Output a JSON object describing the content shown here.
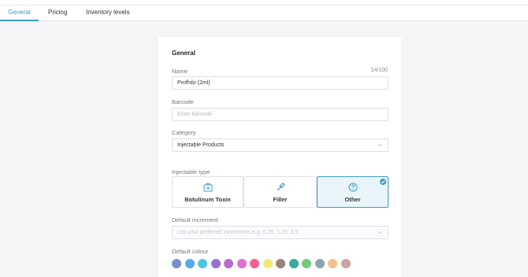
{
  "tabs": [
    {
      "label": "General"
    },
    {
      "label": "Pricing"
    },
    {
      "label": "Inventory levels"
    }
  ],
  "form": {
    "section_title": "General",
    "name": {
      "label": "Name",
      "counter": "14/100",
      "value": "Profhilo (2ml)"
    },
    "barcode": {
      "label": "Barcode",
      "placeholder": "Enter barcode"
    },
    "category": {
      "label": "Category",
      "value": "Injectable Products"
    },
    "injectable_type": {
      "label": "Injectable type",
      "options": [
        {
          "label": "Botulinum Toxin",
          "icon": "medical-kit-icon"
        },
        {
          "label": "Filler",
          "icon": "syringe-icon"
        },
        {
          "label": "Other",
          "icon": "question-icon",
          "selected": true
        }
      ]
    },
    "default_increment": {
      "label": "Default increment",
      "placeholder": "List your preferred increments e.g. 0.25, 1.25, 3.5"
    },
    "default_colour": {
      "label": "Default colour",
      "colors": [
        "#7b8fce",
        "#57abe6",
        "#4ec5dc",
        "#9574cd",
        "#ba6ad1",
        "#df6fd3",
        "#f06292",
        "#f2ea6f",
        "#9a8279",
        "#36ad9a",
        "#76c77c",
        "#8ea3ae",
        "#f6c08b",
        "#cba3a0"
      ]
    },
    "accent_color": "#3d9cc0"
  }
}
